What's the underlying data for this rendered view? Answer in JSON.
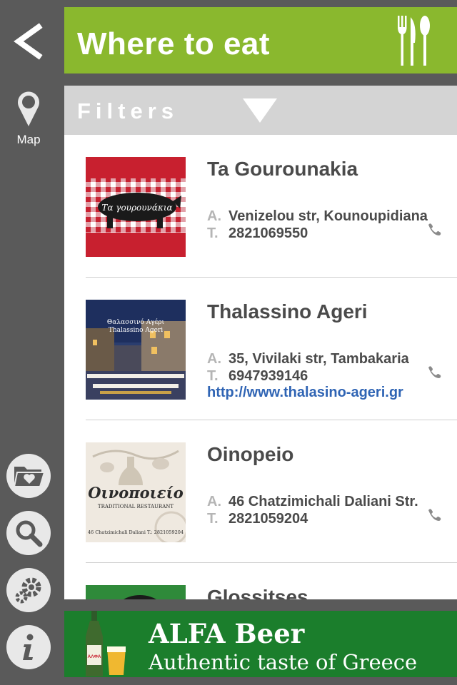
{
  "sidebar": {
    "map_label": "Map",
    "icons": [
      "back-arrow-icon",
      "map-pin-icon",
      "favorites-folder-icon",
      "search-icon",
      "settings-gear-icon",
      "info-icon"
    ]
  },
  "header": {
    "title": "Where to eat",
    "icon": "cutlery-icon",
    "color": "#8ab82e"
  },
  "filters": {
    "label": "Filters",
    "icon": "dropdown-triangle-icon"
  },
  "restaurants": [
    {
      "name": "Ta Gourounakia",
      "logo_text": "Τα γουρουνάκια",
      "address_key": "A.",
      "address": "Venizelou str, Kounoupidiana",
      "phone_key": "T.",
      "phone": "2821069550",
      "url": ""
    },
    {
      "name": "Thalassino Ageri",
      "logo_text_1": "Θαλασσινό Αγέρι",
      "logo_text_2": "Thalassino Ageri",
      "address_key": "A.",
      "address": "35, Vivilaki str, Tambakaria",
      "phone_key": "T.",
      "phone": "6947939146",
      "url": "http://www.thalasino-ageri.gr"
    },
    {
      "name": "Oinopeio",
      "logo_text_1": "Οινοποιείο",
      "logo_text_2": "TRADITIONAL RESTAURANT",
      "logo_text_3": "46 Chatzimichali Daliani T.: 2821059204",
      "address_key": "A.",
      "address": "46 Chatzimichali Daliani Str.",
      "phone_key": "T.",
      "phone": "2821059204",
      "url": ""
    },
    {
      "name": "Glossitses"
    }
  ],
  "ad": {
    "title": "ALFA Beer",
    "subtitle": "Authentic taste of Greece",
    "bottle_label": "ΑΛΦΑ",
    "background": "#1b7e2c"
  }
}
